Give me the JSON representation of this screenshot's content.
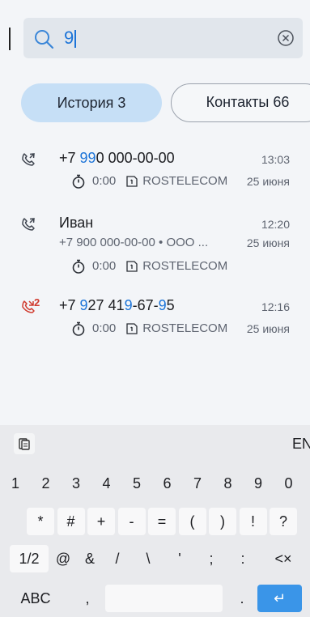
{
  "search": {
    "query": "9"
  },
  "tabs": [
    {
      "label": "История 3",
      "active": true
    },
    {
      "label": "Контакты 66",
      "active": false
    }
  ],
  "calls": [
    {
      "kind": "outgoing",
      "title_parts": [
        {
          "text": "+7 ",
          "hl": false
        },
        {
          "text": "99",
          "hl": true
        },
        {
          "text": "0 000-00-00",
          "hl": false
        }
      ],
      "time": "13:03",
      "date": "25 июня",
      "duration": "0:00",
      "operator": "ROSTELECOM"
    },
    {
      "kind": "outgoing",
      "title_parts": [
        {
          "text": "Иван",
          "hl": false
        }
      ],
      "time": "12:20",
      "sub_parts": [
        {
          "text": "+7 ",
          "hl": false
        },
        {
          "text": "9",
          "hl": true
        },
        {
          "text": "00 000-00-00 • ООО ...",
          "hl": false
        }
      ],
      "date": "25 июня",
      "duration": "0:00",
      "operator": "ROSTELECOM"
    },
    {
      "kind": "missed",
      "count": "2",
      "title_parts": [
        {
          "text": "+7 ",
          "hl": false
        },
        {
          "text": "9",
          "hl": true
        },
        {
          "text": "27 41",
          "hl": false
        },
        {
          "text": "9",
          "hl": true
        },
        {
          "text": "-67-",
          "hl": false
        },
        {
          "text": "9",
          "hl": true
        },
        {
          "text": "5",
          "hl": false
        }
      ],
      "time": "12:16",
      "date": "25 июня",
      "duration": "0:00",
      "operator": "ROSTELECOM"
    }
  ],
  "keyboard": {
    "lang": "EN",
    "digits": [
      "1",
      "2",
      "3",
      "4",
      "5",
      "6",
      "7",
      "8",
      "9",
      "0"
    ],
    "symbols": [
      "*",
      "#",
      "+",
      "-",
      "=",
      "(",
      ")",
      "!",
      "?"
    ],
    "row3": [
      "1/2",
      "@",
      "&",
      "/",
      "\\",
      "'",
      ";",
      ":",
      "<×"
    ],
    "row4": [
      "ABC",
      ",",
      "",
      ".",
      "↵"
    ]
  },
  "colors": {
    "accent": "#1c74d8",
    "missed": "#d03a2e",
    "tab_active": "#c6dff6",
    "enter_key": "#3a95e8"
  }
}
